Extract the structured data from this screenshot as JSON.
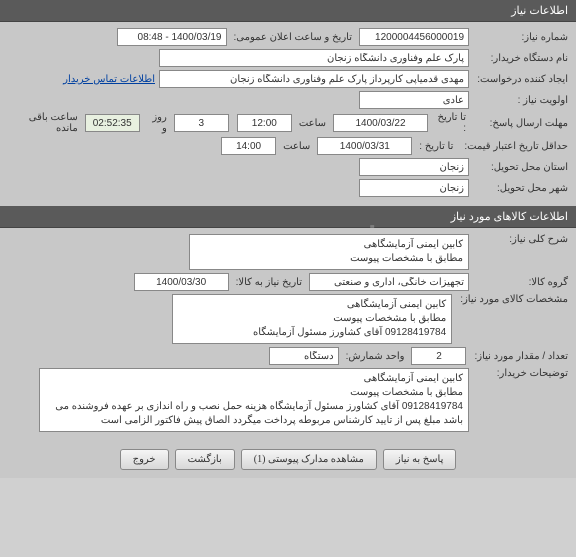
{
  "section1": {
    "title": "اطلاعات نیاز",
    "needNumber": {
      "label": "شماره نیاز:",
      "value": "1200004456000019"
    },
    "announceDate": {
      "label": "تاریخ و ساعت اعلان عمومی:",
      "value": "1400/03/19 - 08:48"
    },
    "buyerOrg": {
      "label": "نام دستگاه خریدار:",
      "value": "پارک علم وفناوری دانشگاه زنجان"
    },
    "creator": {
      "label": "ایجاد کننده درخواست:",
      "value": "مهدی قدمیاپی کارپرداز پارک علم وفناوری دانشگاه زنجان"
    },
    "contactLink": "اطلاعات تماس خریدار",
    "priority": {
      "label": "اولویت نیاز :",
      "value": "عادی"
    },
    "responseDeadline": {
      "label": "مهلت ارسال پاسخ:",
      "toDateLabel": "تا تاریخ :",
      "date": "1400/03/22",
      "timeLabel": "ساعت",
      "time": "12:00",
      "daysValue": "3",
      "daysLabel": "روز و",
      "remainTime": "02:52:35",
      "remainLabel": "ساعت باقی مانده"
    },
    "validityDeadline": {
      "label": "حداقل تاریخ اعتبار قیمت:",
      "toDateLabel": "تا تاریخ :",
      "date": "1400/03/31",
      "timeLabel": "ساعت",
      "time": "14:00"
    },
    "deliveryProvince": {
      "label": "استان محل تحویل:",
      "value": "زنجان"
    },
    "deliveryCity": {
      "label": "شهر محل تحویل:",
      "value": "زنجان"
    }
  },
  "section2": {
    "title": "اطلاعات کالاهای مورد نیاز",
    "needTitle": {
      "label": "شرح کلی نیاز:",
      "value": "کابین ایمنی آزمایشگاهی\nمطابق با مشخصات پیوست"
    },
    "goodsGroup": {
      "label": "گروه کالا:",
      "value": "تجهیزات خانگی، اداری و صنعتی"
    },
    "needByDate": {
      "label": "تاریخ نیاز به کالا:",
      "value": "1400/03/30"
    },
    "goodsSpec": {
      "label": "مشخصات کالای مورد نیاز:",
      "value": "کابین ایمنی آزمایشگاهی\nمطابق با مشخصات پیوست\n09128419784 آقای کشاورز مسئول آزمایشگاه"
    },
    "quantity": {
      "label": "تعداد / مقدار مورد نیاز:",
      "value": "2"
    },
    "unit": {
      "label": "واحد شمارش:",
      "value": "دستگاه"
    },
    "buyerNotes": {
      "label": "توضیحات خریدار:",
      "value": "کابین ایمنی آزمایشگاهی\nمطابق با مشخصات پیوست\n09128419784 آقای کشاورز مسئول آزمایشگاه هزینه حمل نصب و راه اندازی بر عهده فروشنده می باشد مبلغ پس از تایید کارشناس مربوطه پرداخت میگردد الصاق پیش فاکتور الزامی است"
    }
  },
  "buttons": {
    "respond": "پاسخ به نیاز",
    "viewAttachments": "مشاهده مدارک پیوستی (1)",
    "back": "بازگشت",
    "close": "خروج"
  }
}
